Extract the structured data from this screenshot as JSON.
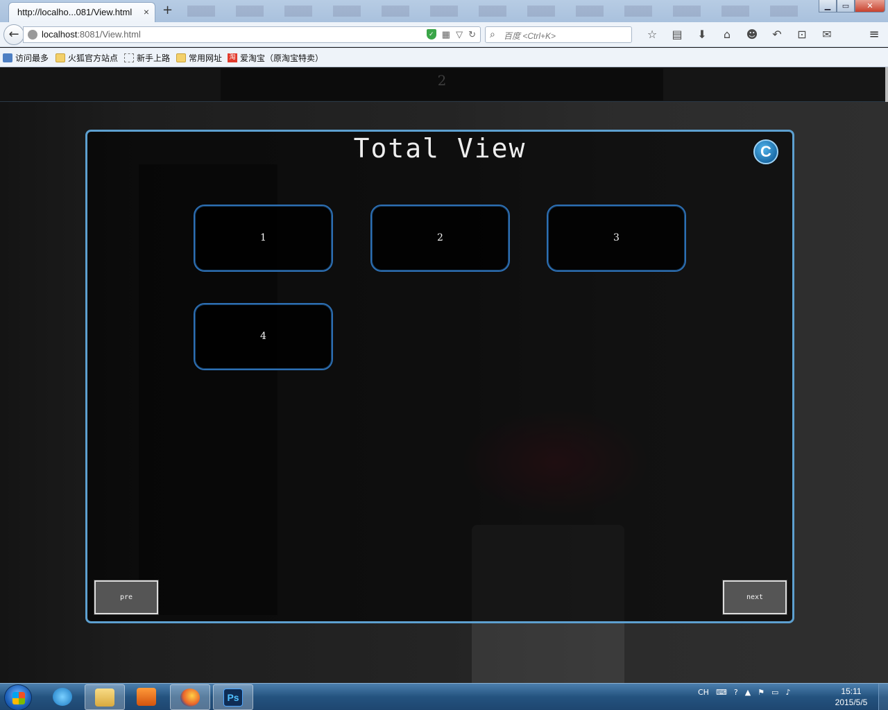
{
  "browser": {
    "tab_title": "http://localho...081/View.html",
    "tab_close": "×",
    "new_tab": "+",
    "window_buttons": {
      "minimize": "▁",
      "maximize": "▭",
      "close": "✕"
    },
    "back": "←",
    "url_host": "localhost",
    "url_rest": ":8081/View.html",
    "search_placeholder": "百度 <Ctrl+K>",
    "toolbar_icons": [
      "star-icon",
      "reading-list-icon",
      "download-icon",
      "home-icon",
      "chat-icon",
      "undo-icon",
      "crop-icon",
      "comment-icon"
    ],
    "toolbar_glyphs": [
      "☆",
      "▤",
      "⬇",
      "⌂",
      "☻",
      "↶",
      "⊡",
      "✉"
    ],
    "menu_glyph": "≡"
  },
  "bookmarks": [
    {
      "label": "访问最多",
      "icon": "most-visited-icon"
    },
    {
      "label": "火狐官方站点",
      "icon": "folder-icon"
    },
    {
      "label": "新手上路",
      "icon": "page-icon"
    },
    {
      "label": "常用网址",
      "icon": "folder-icon"
    },
    {
      "label": "爱淘宝（原淘宝特卖）",
      "icon": "taobao-icon",
      "glyph": "淘"
    }
  ],
  "page": {
    "top_strip_text": "2",
    "title": "Total View",
    "corner_button": "C",
    "items": [
      "1",
      "2",
      "3",
      "4"
    ],
    "pre_label": "pre",
    "next_label": "next"
  },
  "taskbar": {
    "apps": [
      "internet-explorer",
      "file-explorer",
      "media-player",
      "firefox",
      "photoshop"
    ],
    "ps_label": "Ps",
    "tray": {
      "language": "CH",
      "glyphs": [
        "⌨",
        "?",
        "▲",
        "⚑",
        "▭",
        "♪"
      ]
    },
    "time": "15:11",
    "date": "2015/5/5"
  },
  "colors": {
    "panel_border": "#5da0d0",
    "item_border": "#2d6fb3",
    "corner_button": "#1c6da8"
  }
}
